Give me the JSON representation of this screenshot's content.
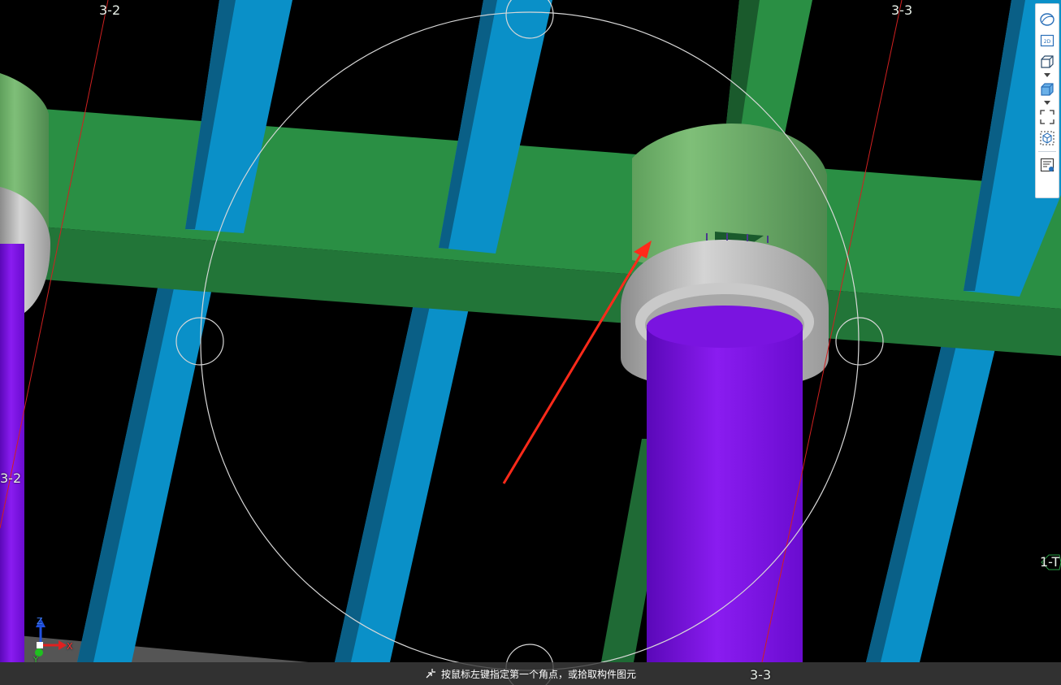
{
  "viewport": {
    "grid_labels": {
      "top_left": "3-2",
      "top_right": "3-3",
      "left_edge": "3-2",
      "right_edge": "1-T",
      "bottom": "3-3"
    },
    "axis_gizmo": {
      "z": "Z",
      "x": "X",
      "y": "Y"
    },
    "colors": {
      "background": "#000000",
      "beam_green": "#2a8f44",
      "beam_blue": "#0a90c8",
      "column_purple": "#7a14e0",
      "cap_grey": "#bdbdbd",
      "cap_green": "#6fae6a",
      "grid_line_red": "#d02020",
      "arrow_red": "#ff2a1a"
    }
  },
  "toolbar": {
    "items": [
      {
        "icon": "orbit-icon"
      },
      {
        "icon": "2d-view-icon",
        "label": "2D"
      },
      {
        "icon": "cube-wireframe-icon"
      },
      {
        "icon": "cube-solid-icon"
      },
      {
        "icon": "zoom-extents-icon"
      },
      {
        "icon": "cube-select-icon"
      },
      {
        "icon": "properties-panel-icon"
      }
    ]
  },
  "status_bar": {
    "icon": "cursor-corner-icon",
    "message": "按鼠标左键指定第一个角点，或拾取构件图元"
  }
}
